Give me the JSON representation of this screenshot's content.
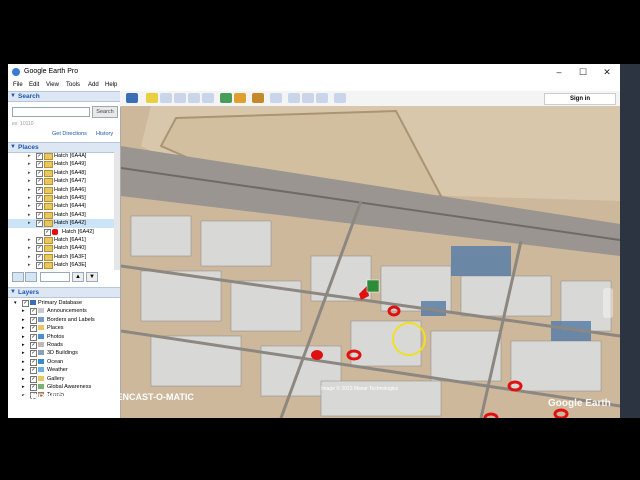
{
  "window": {
    "title": "Google Earth Pro"
  },
  "menu": [
    "File",
    "Edit",
    "View",
    "Tools",
    "Add",
    "Help"
  ],
  "search": {
    "header": "Search",
    "button": "Search",
    "hint": "ex: 10110",
    "directions": "Get Directions",
    "history": "History"
  },
  "places": {
    "header": "Places",
    "items": [
      {
        "label": "Hatch [6A4A]"
      },
      {
        "label": "Hatch [6A49]"
      },
      {
        "label": "Hatch [6A48]"
      },
      {
        "label": "Hatch [6A47]"
      },
      {
        "label": "Hatch [6A46]"
      },
      {
        "label": "Hatch [6A45]"
      },
      {
        "label": "Hatch [6A44]"
      },
      {
        "label": "Hatch [6A43]"
      },
      {
        "label": "Hatch [6A42]"
      },
      {
        "label": "Hatch [6A42]"
      },
      {
        "label": "Hatch [6A41]"
      },
      {
        "label": "Hatch [6A40]"
      },
      {
        "label": "Hatch [6A3F]"
      },
      {
        "label": "Hatch [6A3E]"
      }
    ]
  },
  "layers": {
    "header": "Layers",
    "items": [
      {
        "label": "Primary Database"
      },
      {
        "label": "Announcements"
      },
      {
        "label": "Borders and Labels"
      },
      {
        "label": "Places"
      },
      {
        "label": "Photos"
      },
      {
        "label": "Roads"
      },
      {
        "label": "3D Buildings"
      },
      {
        "label": "Ocean"
      },
      {
        "label": "Weather"
      },
      {
        "label": "Gallery"
      },
      {
        "label": "Global Awareness"
      },
      {
        "label": "Terrain"
      }
    ]
  },
  "toolbar": {
    "signin": "Sign in"
  },
  "map": {
    "brand": "Google Earth",
    "credit": "Image © 2023 Maxar Technologies"
  },
  "watermark": "RECORDED WITH SCREENCAST-O-MATIC",
  "colors": {
    "accent": "#1a58b0",
    "selection": "#cce4f7",
    "annotation": "#e01010",
    "highlight": "#f0e020"
  }
}
